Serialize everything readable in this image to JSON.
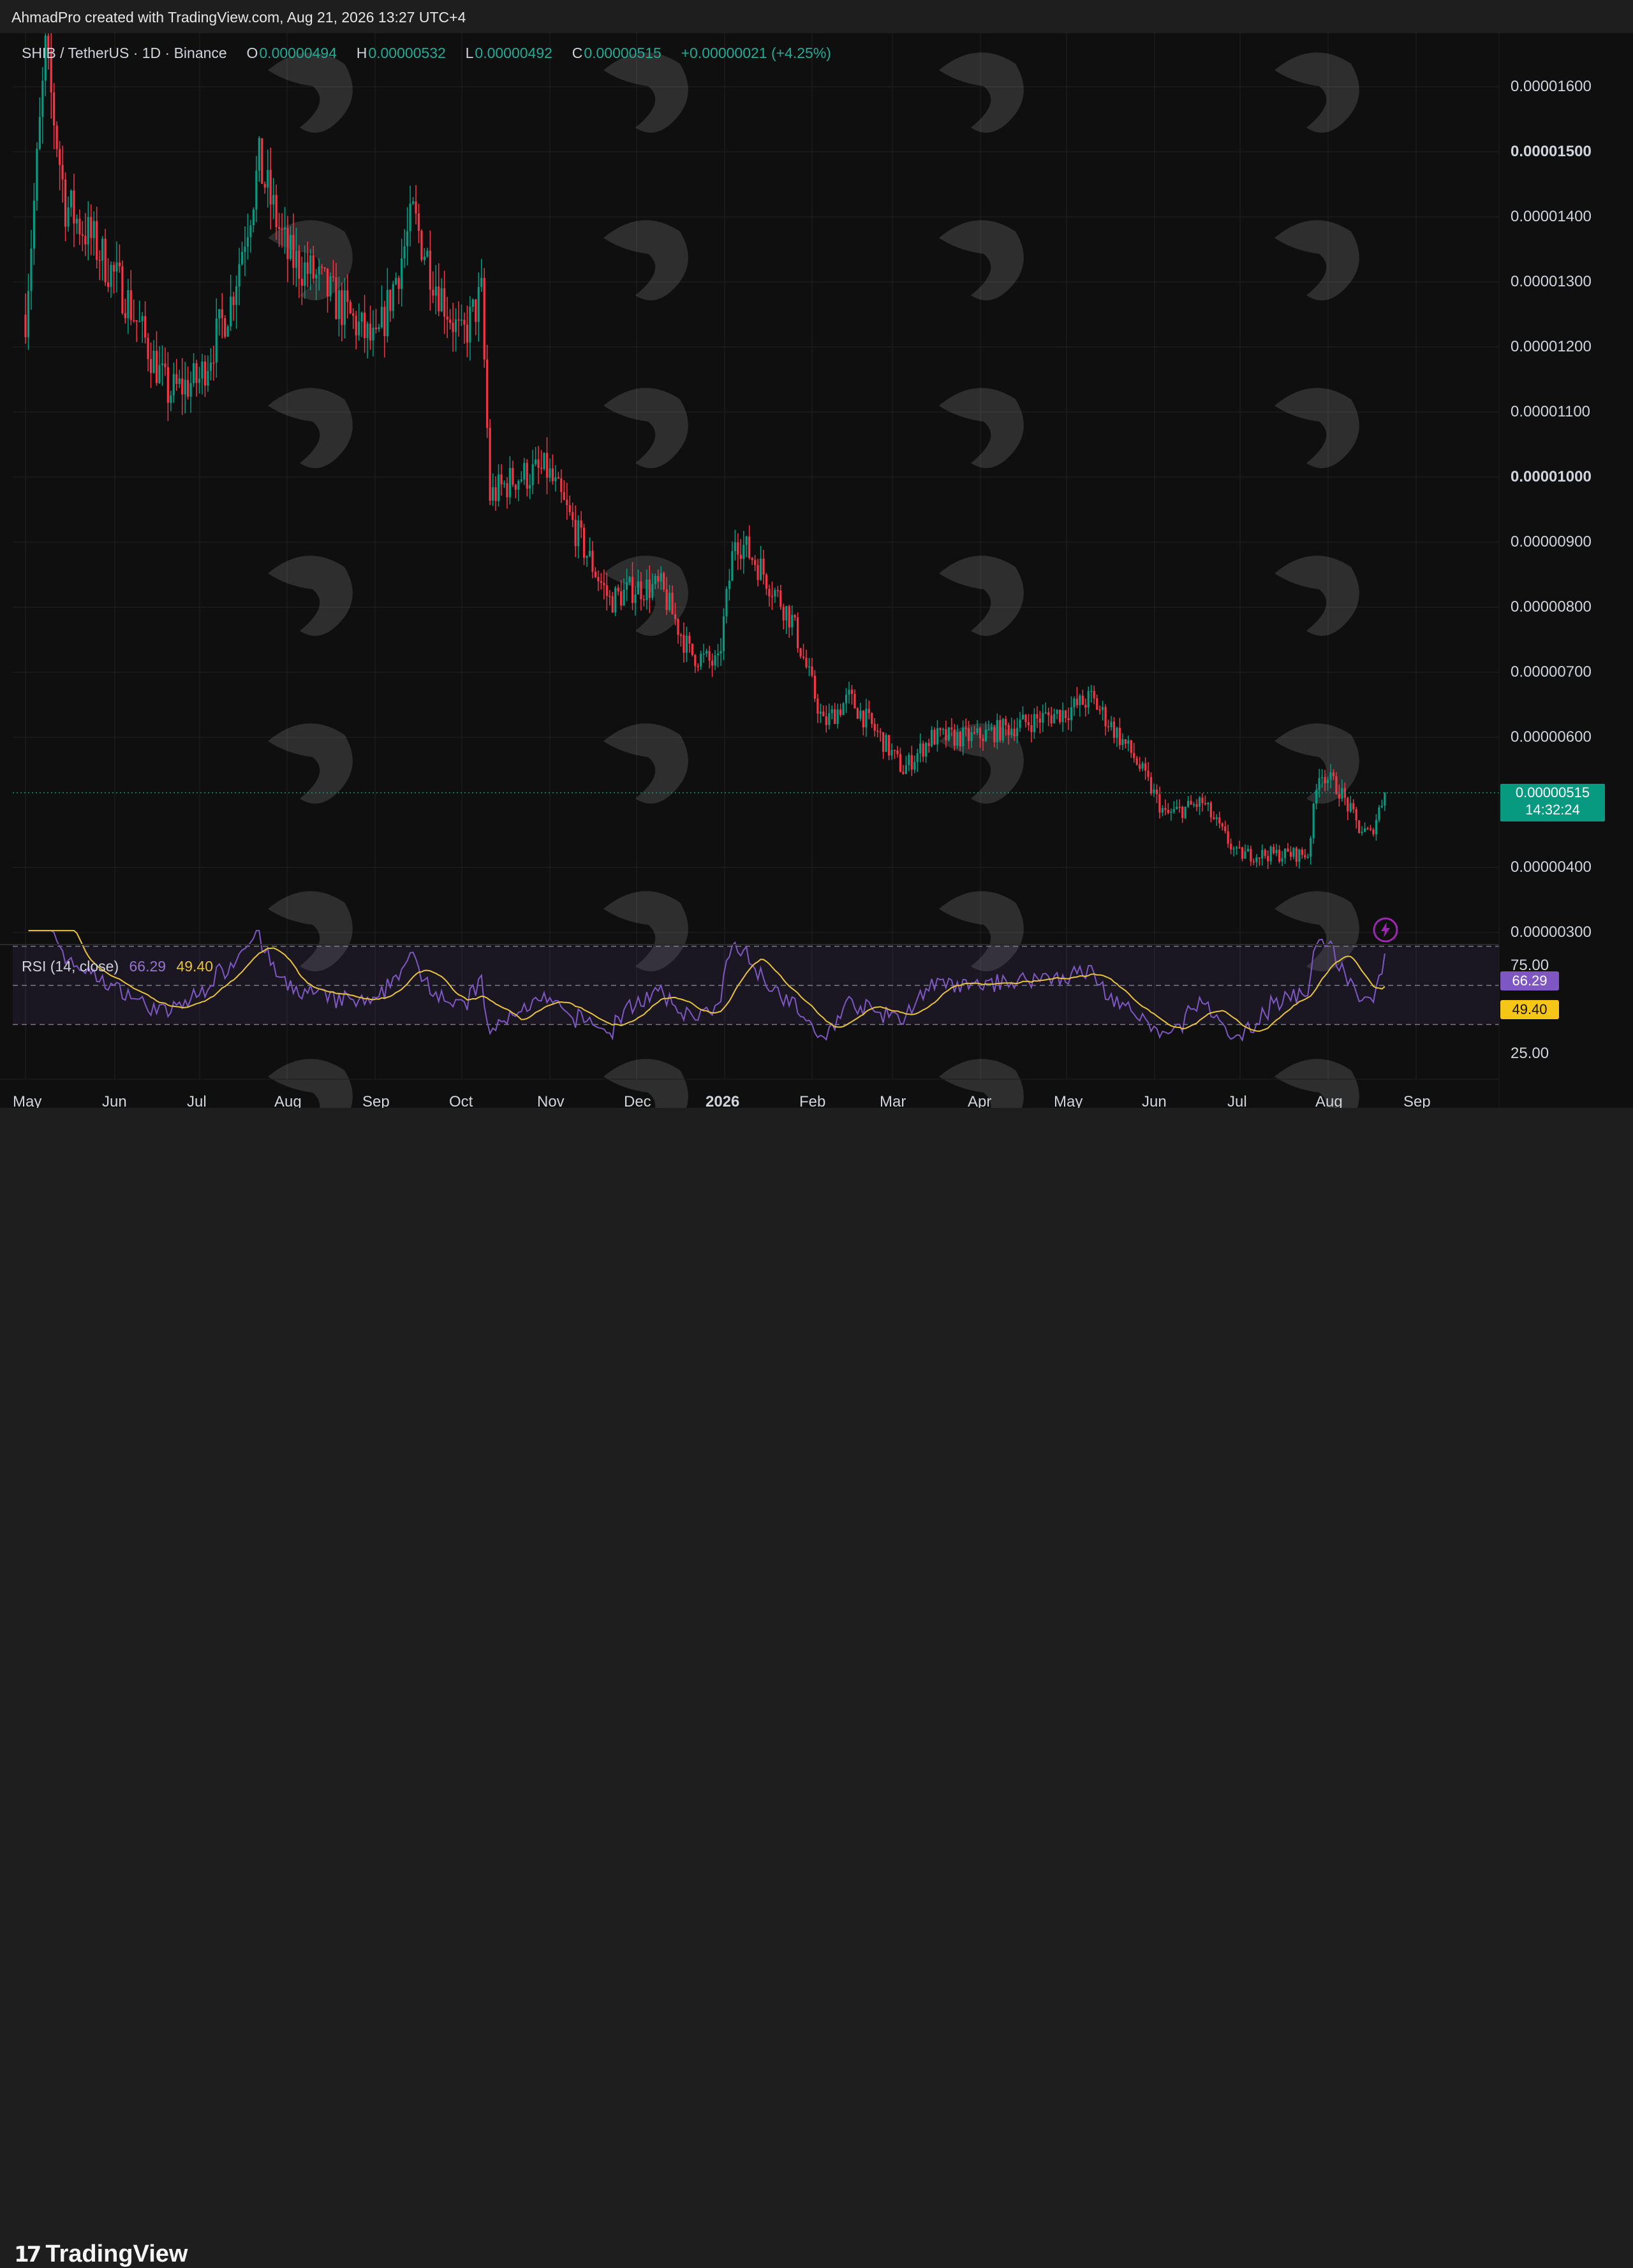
{
  "header": {
    "credit": "AhmadPro created with TradingView.com, Aug 21, 2026 13:27 UTC+4"
  },
  "legend": {
    "symbol": "SHIB / TetherUS · 1D · Binance",
    "o_label": "O",
    "o": "0.00000494",
    "h_label": "H",
    "h": "0.00000532",
    "l_label": "L",
    "l": "0.00000492",
    "c_label": "C",
    "c": "0.00000515",
    "change": "+0.00000021 (+4.25%)"
  },
  "price_tag": {
    "price": "0.00000515",
    "countdown": "14:32:24"
  },
  "rsi": {
    "title": "RSI (14, close)",
    "value": "66.29",
    "ma": "49.40"
  },
  "rsi_axis": {
    "top": "75.00",
    "bottom": "25.00"
  },
  "colors": {
    "up": "#089981",
    "down": "#f23645",
    "rsi": "#7e57c2",
    "rsi_ma": "#e8c33b",
    "background": "#0f0f10"
  },
  "icons": [
    "lightning-icon",
    "tradingview-logo-icon"
  ],
  "footer": {
    "logo_text": "TradingView",
    "logo_mark": "17"
  },
  "chart_data": {
    "type": "candlestick",
    "title": "SHIB / TetherUS · 1D · Binance",
    "y_axis_ticks": [
      "0.00001600",
      "0.00001500",
      "0.00001400",
      "0.00001300",
      "0.00001200",
      "0.00001100",
      "0.00001000",
      "0.00000900",
      "0.00000800",
      "0.00000700",
      "0.00000600",
      "0.00000400",
      "0.00000300"
    ],
    "x_axis_ticks": [
      "May",
      "Jun",
      "Jul",
      "Aug",
      "Sep",
      "Oct",
      "Nov",
      "Dec",
      "2026",
      "Feb",
      "Mar",
      "Apr",
      "May",
      "Jun",
      "Jul",
      "Aug",
      "Sep"
    ],
    "ylim": [
      2.8e-06,
      1.68e-05
    ],
    "grid": true,
    "last_price": 5.15e-06,
    "price_path": [
      [
        "2025-05-01",
        1.25e-05
      ],
      [
        "2025-05-08",
        1.65e-05
      ],
      [
        "2025-05-15",
        1.42e-05
      ],
      [
        "2025-05-25",
        1.36e-05
      ],
      [
        "2025-06-05",
        1.28e-05
      ],
      [
        "2025-06-20",
        1.13e-05
      ],
      [
        "2025-07-01",
        1.15e-05
      ],
      [
        "2025-07-12",
        1.27e-05
      ],
      [
        "2025-07-22",
        1.48e-05
      ],
      [
        "2025-08-01",
        1.34e-05
      ],
      [
        "2025-08-10",
        1.31e-05
      ],
      [
        "2025-08-20",
        1.26e-05
      ],
      [
        "2025-09-01",
        1.2e-05
      ],
      [
        "2025-09-14",
        1.4e-05
      ],
      [
        "2025-09-22",
        1.3e-05
      ],
      [
        "2025-10-01",
        1.21e-05
      ],
      [
        "2025-10-08",
        1.28e-05
      ],
      [
        "2025-10-11",
        9.7e-06
      ],
      [
        "2025-10-20",
        1e-05
      ],
      [
        "2025-10-31",
        1.01e-05
      ],
      [
        "2025-11-12",
        9e-06
      ],
      [
        "2025-11-22",
        8.1e-06
      ],
      [
        "2025-12-01",
        8.3e-06
      ],
      [
        "2025-12-10",
        8.3e-06
      ],
      [
        "2025-12-20",
        7.3e-06
      ],
      [
        "2025-12-30",
        7.1e-06
      ],
      [
        "2026-01-05",
        9.1e-06
      ],
      [
        "2026-01-14",
        8.6e-06
      ],
      [
        "2026-01-25",
        7.8e-06
      ],
      [
        "2026-02-05",
        6.2e-06
      ],
      [
        "2026-02-14",
        6.6e-06
      ],
      [
        "2026-02-25",
        6e-06
      ],
      [
        "2026-03-05",
        5.5e-06
      ],
      [
        "2026-03-15",
        6e-06
      ],
      [
        "2026-03-30",
        6e-06
      ],
      [
        "2026-04-15",
        6.2e-06
      ],
      [
        "2026-05-01",
        6.4e-06
      ],
      [
        "2026-05-10",
        6.6e-06
      ],
      [
        "2026-05-25",
        5.7e-06
      ],
      [
        "2026-06-05",
        4.8e-06
      ],
      [
        "2026-06-18",
        5e-06
      ],
      [
        "2026-06-30",
        4.2e-06
      ],
      [
        "2026-07-15",
        4.2e-06
      ],
      [
        "2026-07-25",
        4.2e-06
      ],
      [
        "2026-07-29",
        5.5e-06
      ],
      [
        "2026-08-05",
        5.2e-06
      ],
      [
        "2026-08-12",
        4.6e-06
      ],
      [
        "2026-08-16",
        4.5e-06
      ],
      [
        "2026-08-21",
        5.15e-06
      ]
    ],
    "rsi_series": {
      "name": "RSI (14, close)",
      "last": 66.29,
      "ma_last": 49.4,
      "ylim": [
        20,
        80
      ],
      "bands": [
        70,
        50,
        30
      ]
    }
  }
}
